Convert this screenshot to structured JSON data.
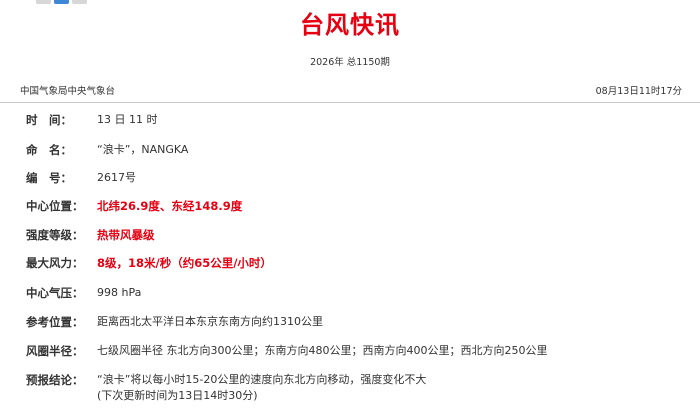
{
  "header": {
    "title": "台风快讯",
    "issue": "2026年 总1150期",
    "source": "中国气象局中央气象台",
    "publish_time": "08月13日11时17分"
  },
  "rows": [
    {
      "label": "时　间：",
      "value": "13 日 11 时"
    },
    {
      "label": "命　名：",
      "value": "“浪卡”，NANGKA"
    },
    {
      "label": "编　号：",
      "value": "2617号"
    },
    {
      "label": "中心位置：",
      "value": "北纬26.9度、东经148.9度",
      "highlight": true
    },
    {
      "label": "强度等级：",
      "value": "热带风暴级",
      "highlight": true
    },
    {
      "label": "最大风力：",
      "value": "8级，18米/秒（约65公里/小时）",
      "highlight": true
    },
    {
      "label": "中心气压：",
      "value": "998 hPa"
    },
    {
      "label": "参考位置：",
      "value": "距离西北太平洋日本东京东南方向约1310公里"
    },
    {
      "label": "风圈半径：",
      "value": "七级风圈半径 东北方向300公里；东南方向480公里；西南方向400公里；西北方向250公里"
    },
    {
      "label": "预报结论：",
      "value": "“浪卡”将以每小时15-20公里的速度向东北方向移动，强度变化不大",
      "value2": "(下次更新时间为13日14时30分)"
    }
  ],
  "colors": {
    "title_red": "#e60012",
    "text": "#333333",
    "divider": "#c9c9c9"
  }
}
